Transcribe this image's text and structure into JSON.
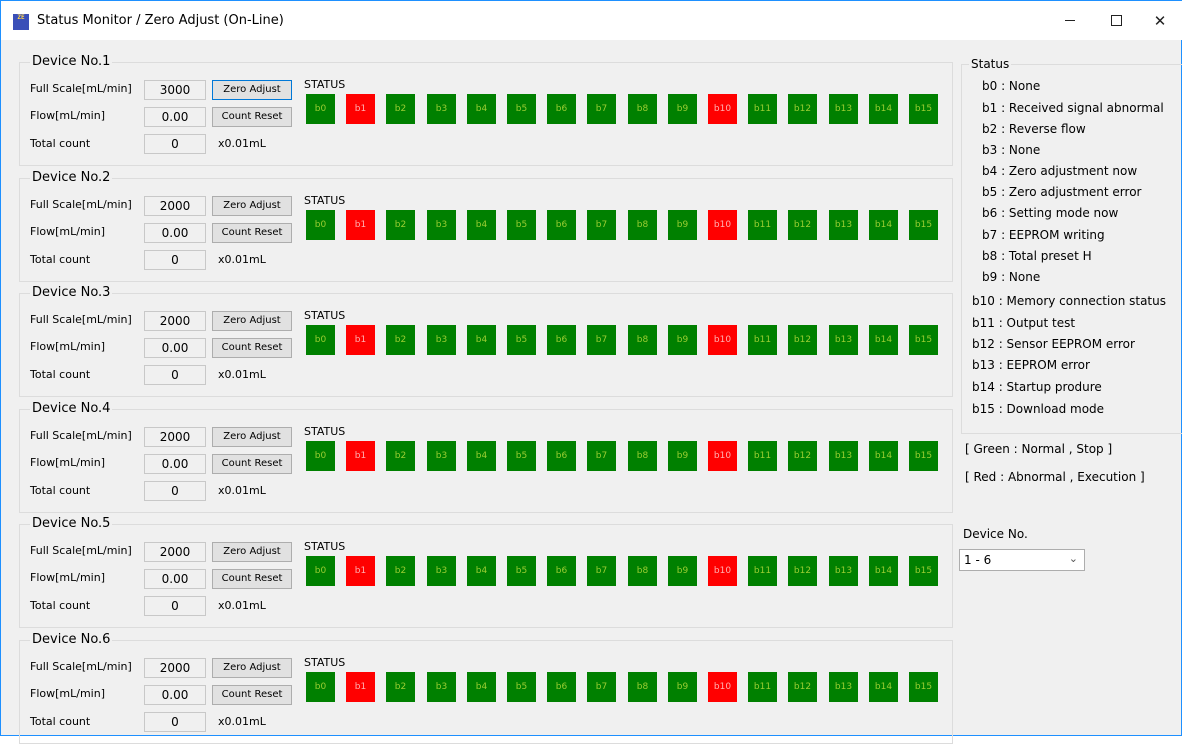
{
  "window": {
    "title": "Status Monitor / Zero Adjust (On-Line)",
    "app_icon_text": "ZE",
    "minimize_label": "",
    "maximize_label": "",
    "close_label": "✕"
  },
  "labels": {
    "full_scale": "Full Scale[mL/min]",
    "flow": "Flow[mL/min]",
    "total_count": "Total count",
    "unit": "x0.01mL",
    "status": "STATUS",
    "zero_adjust": "Zero Adjust",
    "count_reset": "Count Reset"
  },
  "devices": [
    {
      "title": "Device No.1",
      "full_scale": "3000",
      "flow": "0.00",
      "total_count": "0"
    },
    {
      "title": "Device No.2",
      "full_scale": "2000",
      "flow": "0.00",
      "total_count": "0"
    },
    {
      "title": "Device No.3",
      "full_scale": "2000",
      "flow": "0.00",
      "total_count": "0"
    },
    {
      "title": "Device No.4",
      "full_scale": "2000",
      "flow": "0.00",
      "total_count": "0"
    },
    {
      "title": "Device No.5",
      "full_scale": "2000",
      "flow": "0.00",
      "total_count": "0"
    },
    {
      "title": "Device No.6",
      "full_scale": "2000",
      "flow": "0.00",
      "total_count": "0"
    }
  ],
  "bits": {
    "names": [
      "b0",
      "b1",
      "b2",
      "b3",
      "b4",
      "b5",
      "b6",
      "b7",
      "b8",
      "b9",
      "b10",
      "b11",
      "b12",
      "b13",
      "b14",
      "b15"
    ],
    "states": [
      "normal",
      "abnormal",
      "normal",
      "normal",
      "normal",
      "normal",
      "normal",
      "normal",
      "normal",
      "normal",
      "abnormal",
      "normal",
      "normal",
      "normal",
      "normal",
      "normal"
    ]
  },
  "colors": {
    "normal": "#008000",
    "abnormal": "#ff0000",
    "normal_text": "#9acd32",
    "abnormal_text": "#ffb0b0"
  },
  "status_panel": {
    "title": "Status",
    "items": [
      "b0 : None",
      "b1 : Received signal abnormal",
      "b2 : Reverse flow",
      "b3 : None",
      "b4 : Zero adjustment now",
      "b5 : Zero adjustment error",
      "b6 : Setting mode now",
      "b7 : EEPROM writing",
      "b8 : Total preset H",
      "b9 : None",
      "b10 : Memory connection status",
      "b11 : Output test",
      "b12 : Sensor EEPROM error",
      "b13 : EEPROM error",
      "b14 : Startup produre",
      "b15 : Download mode"
    ],
    "legend_green": "[ Green : Normal , Stop ]",
    "legend_red": "[ Red : Abnormal , Execution  ]"
  },
  "device_selector": {
    "label": "Device No.",
    "value": "1 - 6"
  }
}
